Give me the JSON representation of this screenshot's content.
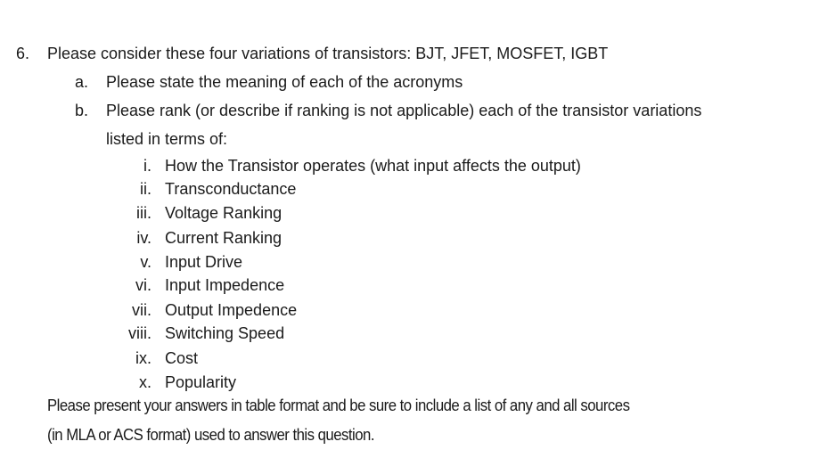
{
  "question": {
    "number": "6.",
    "text": "Please consider these four variations of transistors: BJT, JFET, MOSFET, IGBT",
    "parts": [
      {
        "marker": "a.",
        "text": "Please state the meaning of each of the acronyms"
      },
      {
        "marker": "b.",
        "text_line1": "Please rank (or describe if ranking is not applicable) each of the transistor variations",
        "text_line2": "listed in terms of:",
        "items": [
          {
            "marker": "i.",
            "text": "How the Transistor operates (what input affects the output)"
          },
          {
            "marker": "ii.",
            "text": "Transconductance"
          },
          {
            "marker": "iii.",
            "text": "Voltage Ranking"
          },
          {
            "marker": "iv.",
            "text": "Current Ranking"
          },
          {
            "marker": "v.",
            "text": "Input Drive"
          },
          {
            "marker": "vi.",
            "text": "Input Impedence"
          },
          {
            "marker": "vii.",
            "text": "Output Impedence"
          },
          {
            "marker": "viii.",
            "text": "Switching Speed"
          },
          {
            "marker": "ix.",
            "text": "Cost"
          },
          {
            "marker": "x.",
            "text": "Popularity"
          }
        ]
      }
    ],
    "footer_line1": "Please present your answers in table format and be sure to include a list of any and all sources",
    "footer_line2": "(in MLA or ACS format) used to answer this question."
  }
}
